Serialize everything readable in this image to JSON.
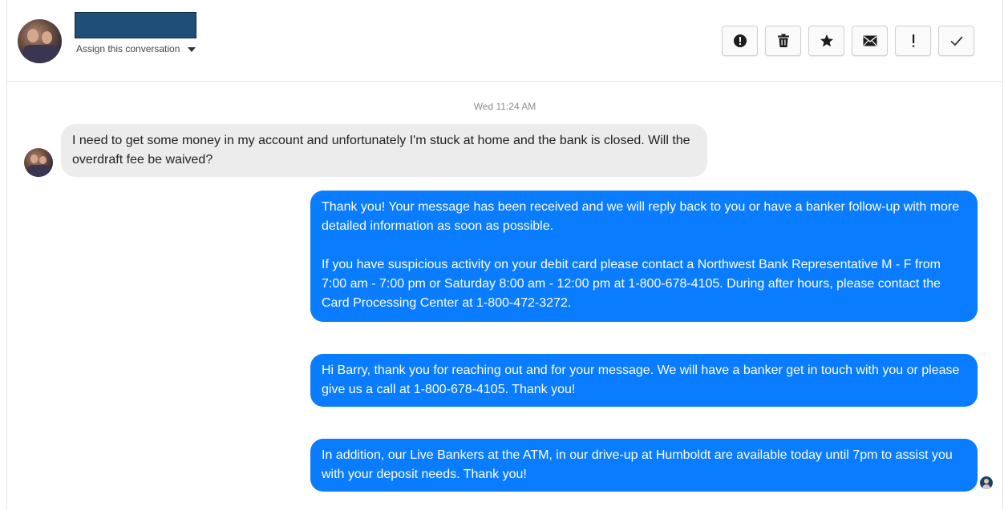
{
  "header": {
    "assign_label": "Assign this conversation"
  },
  "toolbar": {
    "buttons": [
      {
        "name": "alert-circle-icon"
      },
      {
        "name": "trash-icon"
      },
      {
        "name": "star-icon"
      },
      {
        "name": "envelope-icon"
      },
      {
        "name": "exclamation-icon"
      },
      {
        "name": "check-icon"
      }
    ]
  },
  "conversation": {
    "timestamp": "Wed 11:24 AM",
    "incoming": {
      "text": "I need to get some money in my account and unfortunately I'm stuck at home and the bank is closed. Will the overdraft fee be waived?"
    },
    "outgoing": [
      {
        "para1": "Thank you! Your message has been received and we will reply back to you or have a banker follow-up with more detailed information as soon as possible.",
        "para2": "If you have suspicious activity on your debit card please contact a Northwest Bank Representative M - F from 7:00 am - 7:00 pm or Saturday 8:00 am - 12:00 pm at 1-800-678-4105.  During after hours, please contact the Card Processing Center at 1-800-472-3272."
      },
      {
        "text": "Hi Barry, thank you for reaching out and for your message. We will have a banker get in touch with you or please give us a call at 1-800-678-4105. Thank you!"
      },
      {
        "text": "In addition, our Live Bankers at the ATM, in our drive-up at Humboldt are available today until 7pm to assist you with your deposit needs. Thank you!"
      }
    ]
  },
  "colors": {
    "outgoing_bubble": "#0a7cff",
    "incoming_bubble": "#ececec",
    "redaction": "#1f4e79"
  }
}
